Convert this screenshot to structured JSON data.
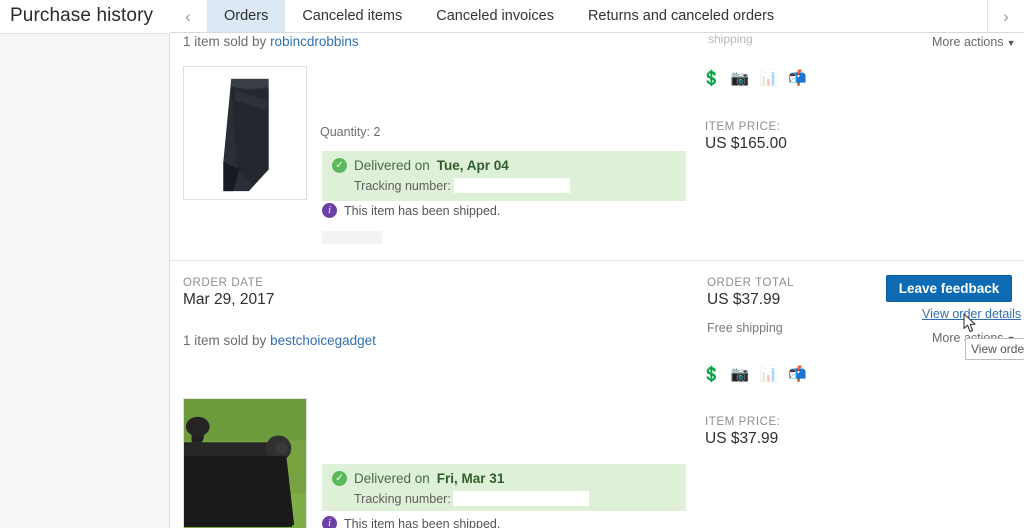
{
  "page": {
    "title": "Purchase history"
  },
  "tabbar": {
    "prev_icon": "chevron-left-icon",
    "next_icon": "chevron-right-icon",
    "tabs": [
      {
        "label": "Orders",
        "active": true
      },
      {
        "label": "Canceled items",
        "active": false
      },
      {
        "label": "Canceled invoices",
        "active": false
      },
      {
        "label": "Returns and canceled orders",
        "active": false
      }
    ]
  },
  "orders": [
    {
      "shipping_text": "shipping",
      "sold_by_prefix": "1 item sold by",
      "seller": "robincdrobbins",
      "quantity_label": "Quantity: 2",
      "delivery": {
        "prefix": "Delivered on",
        "date": "Tue, Apr 04",
        "tracking_label": "Tracking number:",
        "tracking_number": ""
      },
      "shipped_note": "This item has been shipped.",
      "item_price_label": "ITEM PRICE:",
      "item_price": "US $165.00",
      "more_actions": "More actions",
      "icons": [
        "dollar-icon",
        "camera-icon",
        "chart-icon",
        "envelope-icon"
      ]
    },
    {
      "order_date_label": "ORDER DATE",
      "order_date": "Mar 29, 2017",
      "sold_by_prefix": "1 item sold by",
      "seller": "bestchoicegadget",
      "order_total_label": "ORDER TOTAL",
      "order_total": "US $37.99",
      "free_shipping": "Free shipping",
      "leave_feedback": "Leave feedback",
      "view_order_details": "View order details",
      "more_actions": "More actions",
      "tooltip": "View order d",
      "delivery": {
        "prefix": "Delivered on",
        "date": "Fri, Mar 31",
        "tracking_label": "Tracking number:",
        "tracking_number": ""
      },
      "shipped_note": "This item has been shipped.",
      "item_price_label": "ITEM PRICE:",
      "item_price": "US $37.99",
      "icons": [
        "dollar-icon",
        "camera-icon",
        "chart-icon",
        "envelope-icon"
      ]
    }
  ],
  "colors": {
    "accent_blue": "#0d6bb5",
    "link_blue": "#2f6fb3",
    "tab_active_bg": "#dce9f5",
    "delivered_banner": "#dff0d8",
    "check_green": "#5cb85c",
    "info_purple": "#6f3fa8",
    "rail_bg": "#f6f6f6"
  }
}
